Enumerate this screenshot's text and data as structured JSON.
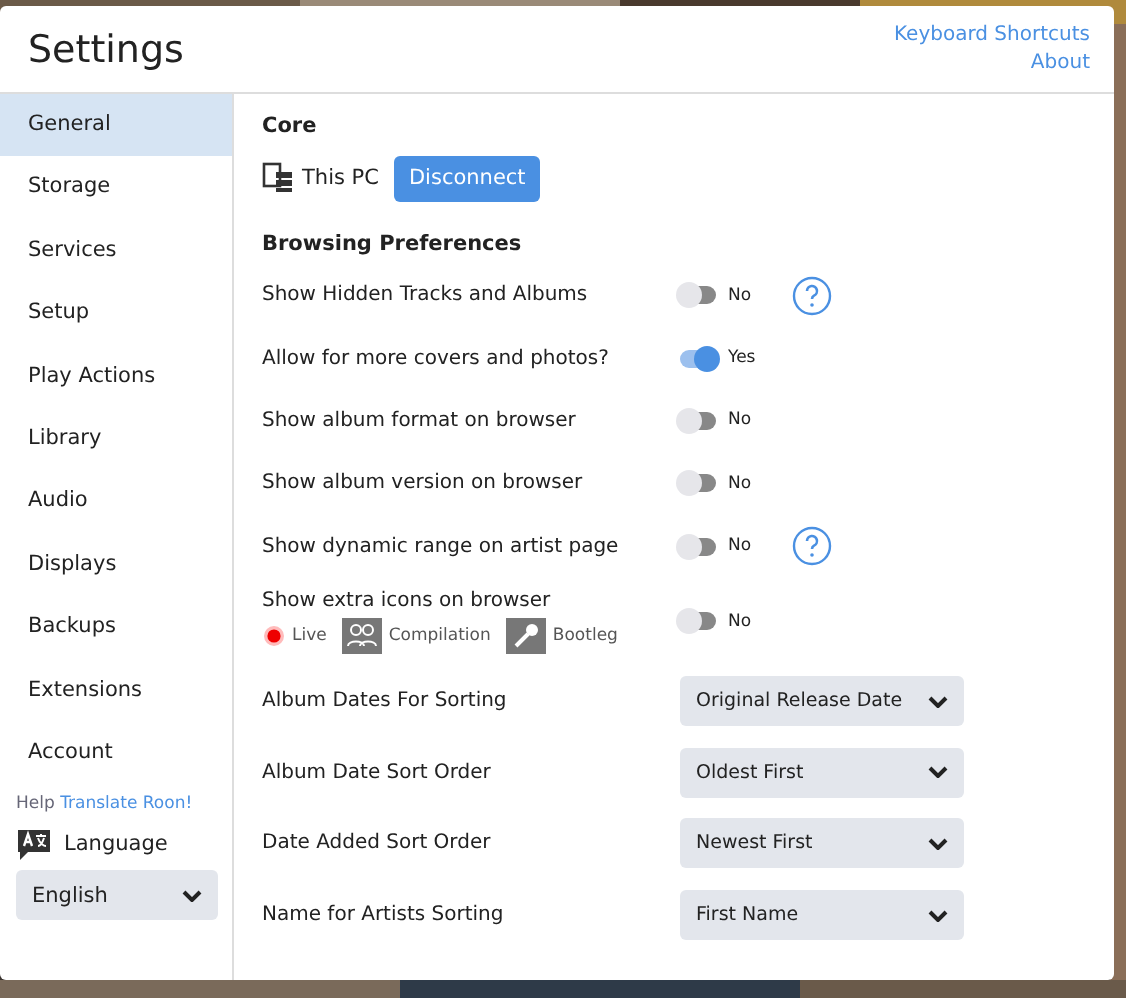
{
  "window": {
    "title": "Settings"
  },
  "header_links": [
    "Keyboard Shortcuts",
    "About"
  ],
  "sidebar": {
    "items": [
      {
        "label": "General",
        "selected": true
      },
      {
        "label": "Storage",
        "selected": false
      },
      {
        "label": "Services",
        "selected": false
      },
      {
        "label": "Setup",
        "selected": false
      },
      {
        "label": "Play Actions",
        "selected": false
      },
      {
        "label": "Library",
        "selected": false
      },
      {
        "label": "Audio",
        "selected": false
      },
      {
        "label": "Displays",
        "selected": false
      },
      {
        "label": "Backups",
        "selected": false
      },
      {
        "label": "Extensions",
        "selected": false
      },
      {
        "label": "Account",
        "selected": false
      }
    ],
    "help_text": "Help",
    "help_link": "Translate Roon!",
    "language_label": "Language",
    "language_value": "English"
  },
  "core": {
    "heading": "Core",
    "device": "This PC",
    "button": "Disconnect"
  },
  "browsing": {
    "heading": "Browsing Preferences",
    "rows": [
      {
        "kind": "toggle",
        "label": "Show Hidden Tracks and Albums",
        "on": false,
        "value": "No",
        "help": true
      },
      {
        "kind": "toggle",
        "label": "Allow for more covers and photos?",
        "on": true,
        "value": "Yes",
        "help": false
      },
      {
        "kind": "toggle",
        "label": "Show album format on browser",
        "on": false,
        "value": "No",
        "help": false
      },
      {
        "kind": "toggle",
        "label": "Show album version on browser",
        "on": false,
        "value": "No",
        "help": false
      },
      {
        "kind": "toggle",
        "label": "Show dynamic range on artist page",
        "on": false,
        "value": "No",
        "help": true
      },
      {
        "kind": "icons",
        "label": "Show extra icons on browser",
        "on": false,
        "value": "No",
        "help": false,
        "badges": [
          {
            "kind": "live",
            "label": "Live"
          },
          {
            "kind": "compilation",
            "label": "Compilation"
          },
          {
            "kind": "bootleg",
            "label": "Bootleg"
          }
        ]
      },
      {
        "kind": "select",
        "label": "Album Dates For Sorting",
        "value": "Original Release Date"
      },
      {
        "kind": "select",
        "label": "Album Date Sort Order",
        "value": "Oldest First"
      },
      {
        "kind": "select",
        "label": "Date Added Sort Order",
        "value": "Newest First"
      },
      {
        "kind": "select",
        "label": "Name for Artists Sorting",
        "value": "First Name"
      }
    ]
  }
}
